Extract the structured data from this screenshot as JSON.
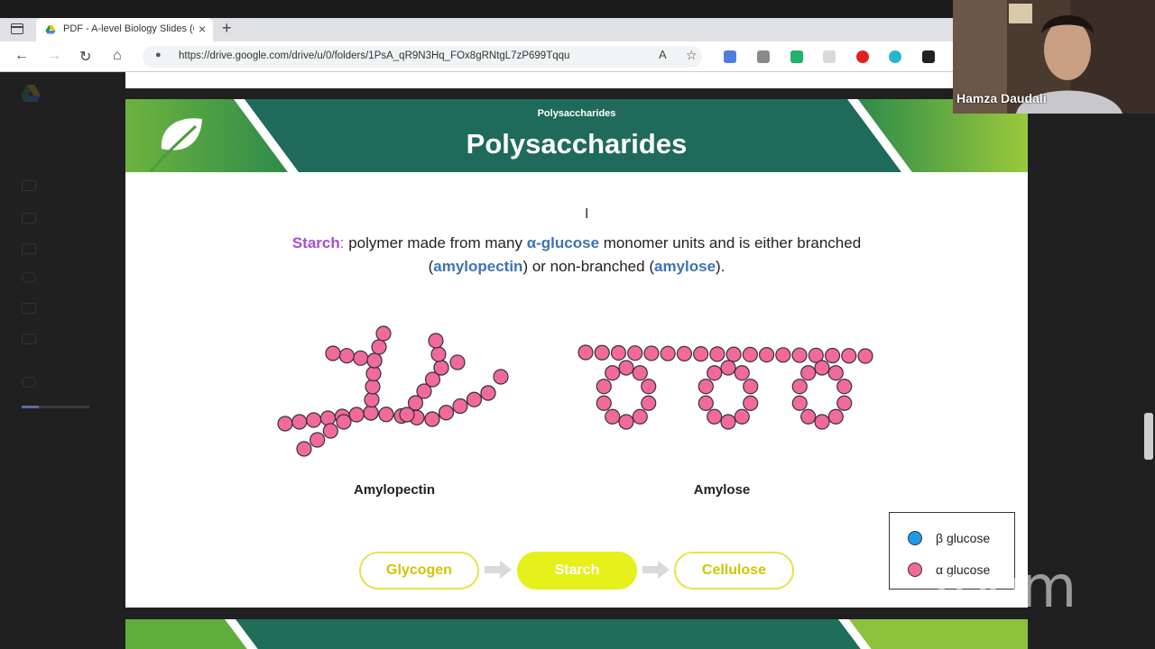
{
  "browser": {
    "tab_title": "PDF - A-level Biology Slides (OC",
    "tab_close": "×",
    "new_tab": "+",
    "url": "https://drive.google.com/drive/u/0/folders/1PsA_qR9N3Hq_FOx8gRNtgL7zP699Tqqu",
    "back_icon": "←",
    "forward_icon": "→",
    "reload_icon": "↻",
    "home_icon": "⌂",
    "lock_icon": "🔒"
  },
  "slide": {
    "subtitle": "Polysaccharides",
    "title": "Polysaccharides",
    "definition": {
      "term": "Starch",
      "colon": ":",
      "text1": " polymer made from many ",
      "kw1": "α-glucose",
      "text2": " monomer units and is either branched (",
      "kw2": "amylopectin",
      "text3": ") or non-branched (",
      "kw3": "amylose",
      "text4": ")."
    },
    "captions": {
      "left": "Amylopectin",
      "right": "Amylose"
    },
    "flow": {
      "item1": "Glycogen",
      "item2": "Starch",
      "item3": "Cellulose"
    },
    "legend": {
      "beta_label": "β glucose",
      "alpha_label": "α glucose"
    }
  },
  "video": {
    "speaker_name": "Hamza Daudali"
  },
  "watermark": "zoom",
  "colors": {
    "header_green": "#1e6e5a",
    "alpha_pink": "#f2699b",
    "beta_blue": "#1e9be8",
    "pill_yellow": "#e6f01b",
    "keyword_blue": "#3d73b8",
    "keyword_purple": "#a24fd6"
  }
}
